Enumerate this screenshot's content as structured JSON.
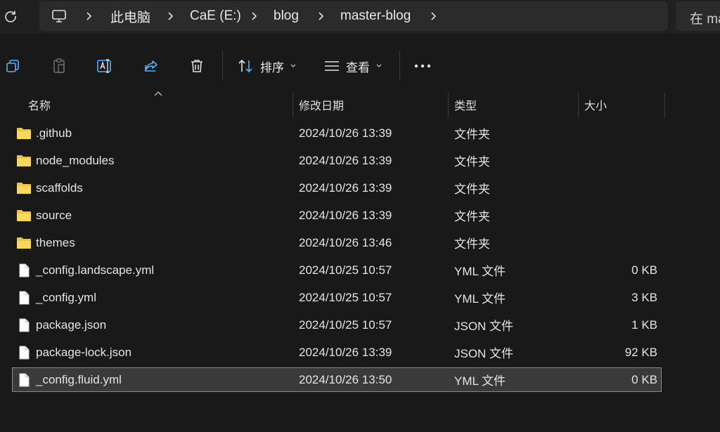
{
  "address": {
    "crumbs": [
      "此电脑",
      "CaE (E:)",
      "blog",
      "master-blog"
    ],
    "search_placeholder": "在 ma"
  },
  "toolbar": {
    "sort_label": "排序",
    "view_label": "查看"
  },
  "columns": [
    "名称",
    "修改日期",
    "类型",
    "大小"
  ],
  "files": [
    {
      "name": ".github",
      "date": "2024/10/26 13:39",
      "type": "文件夹",
      "size": "",
      "icon": "folder-icon"
    },
    {
      "name": "node_modules",
      "date": "2024/10/26 13:39",
      "type": "文件夹",
      "size": "",
      "icon": "folder-icon"
    },
    {
      "name": "scaffolds",
      "date": "2024/10/26 13:39",
      "type": "文件夹",
      "size": "",
      "icon": "folder-icon"
    },
    {
      "name": "source",
      "date": "2024/10/26 13:39",
      "type": "文件夹",
      "size": "",
      "icon": "folder-icon"
    },
    {
      "name": "themes",
      "date": "2024/10/26 13:46",
      "type": "文件夹",
      "size": "",
      "icon": "folder-icon"
    },
    {
      "name": "_config.landscape.yml",
      "date": "2024/10/25 10:57",
      "type": "YML 文件",
      "size": "0 KB",
      "icon": "file-icon"
    },
    {
      "name": "_config.yml",
      "date": "2024/10/25 10:57",
      "type": "YML 文件",
      "size": "3 KB",
      "icon": "file-icon"
    },
    {
      "name": "package.json",
      "date": "2024/10/25 10:57",
      "type": "JSON 文件",
      "size": "1 KB",
      "icon": "file-icon"
    },
    {
      "name": "package-lock.json",
      "date": "2024/10/26 13:39",
      "type": "JSON 文件",
      "size": "92 KB",
      "icon": "file-icon"
    },
    {
      "name": "_config.fluid.yml",
      "date": "2024/10/26 13:50",
      "type": "YML 文件",
      "size": "0 KB",
      "icon": "file-icon",
      "selected": true
    }
  ],
  "colors": {
    "folder": "#f3c53d",
    "background": "#191919",
    "selection": "#3a3a3a"
  }
}
